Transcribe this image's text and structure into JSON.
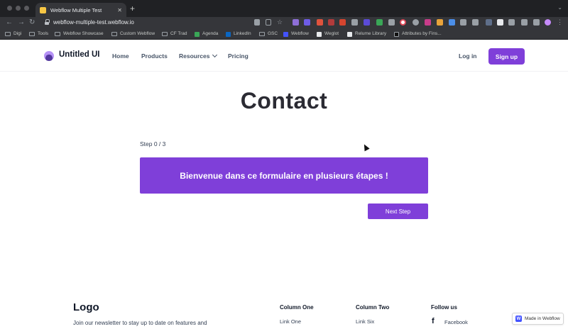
{
  "browser": {
    "tab_title": "Webflow Multiple Test",
    "tab_close": "✕",
    "new_tab": "+",
    "url": "webflow-multiple-test.webflow.io",
    "nav": {
      "back": "←",
      "forward": "→",
      "reload": "↻"
    },
    "bookmarks": [
      "Digi",
      "Tools",
      "Webflow Showcase",
      "Custom Webflow",
      "CF Trad",
      "Agenda",
      "LinkedIn",
      "GSC",
      "Webflow",
      "Weglot",
      "Relume Library",
      "Attributes by Fins..."
    ],
    "colors": {
      "chrome_dark": "#202124",
      "chrome_mid": "#35363a"
    }
  },
  "site": {
    "brand": "Untitled UI",
    "nav": {
      "home": "Home",
      "products": "Products",
      "resources": "Resources",
      "pricing": "Pricing"
    },
    "login": "Log in",
    "signup": "Sign up",
    "accent": "#7f3fd9"
  },
  "form": {
    "title": "Contact",
    "step": "Step 0 / 3",
    "welcome": "Bienvenue dans ce formulaire en plusieurs étapes !",
    "next": "Next Step"
  },
  "footer": {
    "logo": "Logo",
    "newsletter": "Join our newsletter to stay up to date on features and",
    "col1_heading": "Column One",
    "col1_link": "Link One",
    "col2_heading": "Column Two",
    "col2_link": "Link Six",
    "col3_heading": "Follow us",
    "facebook": "Facebook",
    "facebook_icon": "f"
  },
  "badge": {
    "text": "Made in Webflow",
    "mark": "W"
  }
}
